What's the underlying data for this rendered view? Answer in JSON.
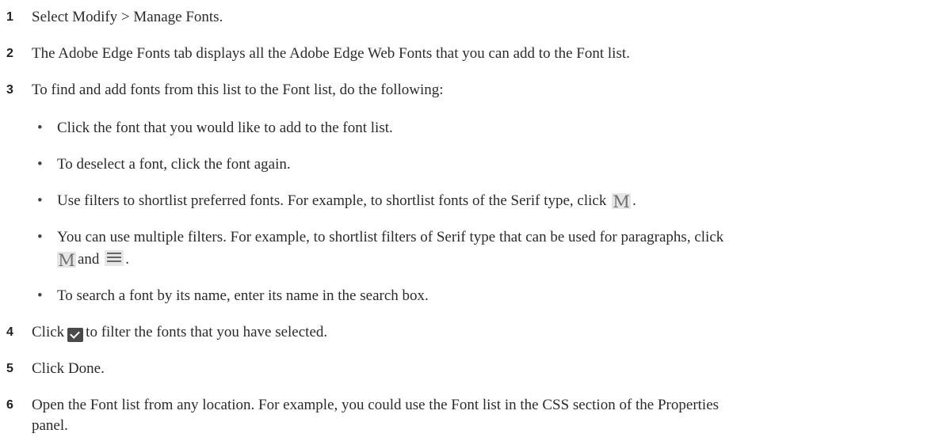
{
  "steps": [
    {
      "num": "1",
      "text": "Select Modify > Manage Fonts."
    },
    {
      "num": "2",
      "text": "The Adobe Edge Fonts tab displays all the Adobe Edge Web Fonts that you can add to the Font list."
    },
    {
      "num": "3",
      "text": "To find and add fonts from this list to the Font list, do the following:"
    },
    {
      "num": "4",
      "text_before": "Click",
      "text_after": "to filter the fonts that you have selected.",
      "icon": "checkmark-filter-icon"
    },
    {
      "num": "5",
      "text": "Click Done."
    },
    {
      "num": "6",
      "text_line1": "Open the Font list from any location. For example, you could use the Font list in the CSS section of the Properties",
      "text_line2": "panel."
    }
  ],
  "substeps": [
    {
      "text": "Click the font that you would like to add to the font list."
    },
    {
      "text": "To deselect a font, click the font again."
    },
    {
      "text_before": "Use filters to shortlist preferred fonts. For example, to shortlist fonts of the Serif type, click",
      "text_after": ".",
      "icon": "serif-filter-icon"
    },
    {
      "text_line1": "You can use multiple filters. For example, to shortlist filters of Serif type that can be used for paragraphs, click",
      "text_between": "and",
      "text_after": ".",
      "icons": [
        "serif-filter-icon",
        "paragraph-filter-icon"
      ]
    },
    {
      "text": "To search a font by its name, enter its name in the search box."
    }
  ],
  "bullet_char": "•",
  "serif_icon_glyph": "M"
}
